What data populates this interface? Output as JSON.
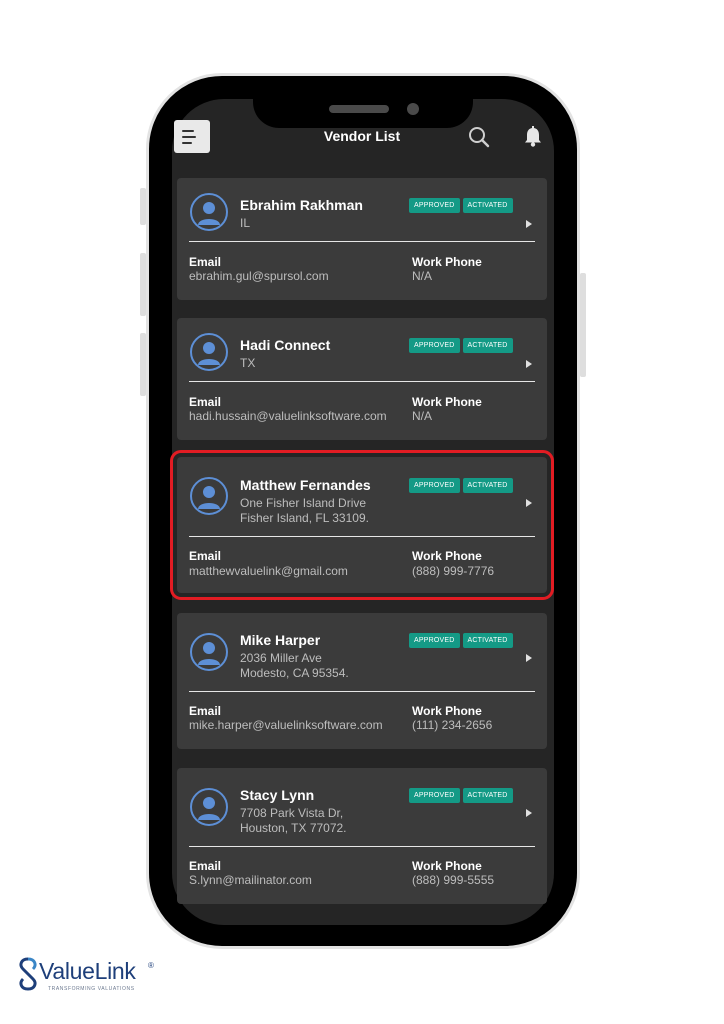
{
  "header": {
    "title": "Vendor List",
    "menu_icon": "menu-icon",
    "search_icon": "search-icon",
    "bell_icon": "bell-icon"
  },
  "vendors": [
    {
      "name": "Ebrahim Rakhman",
      "address_line1": "IL",
      "address_line2": "",
      "badges": [
        "APPROVED",
        "ACTIVATED"
      ],
      "email_label": "Email",
      "email": "ebrahim.gul@spursol.com",
      "phone_label": "Work Phone",
      "phone": "N/A"
    },
    {
      "name": "Hadi Connect",
      "address_line1": "TX",
      "address_line2": "",
      "badges": [
        "APPROVED",
        "ACTIVATED"
      ],
      "email_label": "Email",
      "email": "hadi.hussain@valuelinksoftware.com",
      "phone_label": "Work Phone",
      "phone": "N/A"
    },
    {
      "name": "Matthew Fernandes",
      "address_line1": "One Fisher Island Drive",
      "address_line2": "Fisher Island, FL 33109.",
      "badges": [
        "APPROVED",
        "ACTIVATED"
      ],
      "email_label": "Email",
      "email": "matthewvaluelink@gmail.com",
      "phone_label": "Work Phone",
      "phone": "(888) 999-7776",
      "highlighted": true
    },
    {
      "name": "Mike Harper",
      "address_line1": "2036 Miller Ave",
      "address_line2": "Modesto, CA 95354.",
      "badges": [
        "APPROVED",
        "ACTIVATED"
      ],
      "email_label": "Email",
      "email": "mike.harper@valuelinksoftware.com",
      "phone_label": "Work Phone",
      "phone": "(111) 234-2656"
    },
    {
      "name": "Stacy Lynn",
      "address_line1": "7708 Park Vista Dr,",
      "address_line2": "Houston, TX 77072.",
      "badges": [
        "APPROVED",
        "ACTIVATED"
      ],
      "email_label": "Email",
      "email": "S.lynn@mailinator.com",
      "phone_label": "Work Phone",
      "phone": "(888) 999-5555"
    }
  ],
  "brand": {
    "name": "ValueLink",
    "registered": "®",
    "tagline": "TRANSFORMING VALUATIONS"
  },
  "colors": {
    "badge": "#149a86",
    "highlight": "#e21c23",
    "avatar": "#5d8fd6",
    "card": "#3b3b3b",
    "screen": "#252525"
  }
}
